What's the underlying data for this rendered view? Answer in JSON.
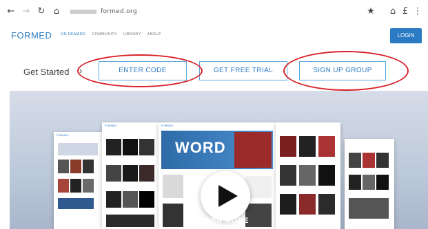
{
  "browser": {
    "url_text": "formed.org",
    "icons": [
      "back-icon",
      "forward-icon",
      "reload-icon",
      "home-icon",
      "star-icon",
      "extension-icon",
      "profile-icon",
      "menu-icon"
    ]
  },
  "site": {
    "logo": "FORMED",
    "nav": [
      "ON DEMAND",
      "COMMUNITY",
      "LIBRARY",
      "ABOUT"
    ],
    "login": "LOGIN"
  },
  "get_started": {
    "label": "Get Started",
    "chevron": "›",
    "buttons": {
      "enter_code": "ENTER CODE",
      "free_trial": "GET FREE TRIAL",
      "sign_up_group": "SIGN UP GROUP"
    },
    "annotation_color": "#d62027"
  },
  "hero": {
    "brand_small": "FORMED",
    "banner_word": "WORD",
    "learn_more": "LEARN MORE",
    "accent": "#2b7bc4"
  }
}
